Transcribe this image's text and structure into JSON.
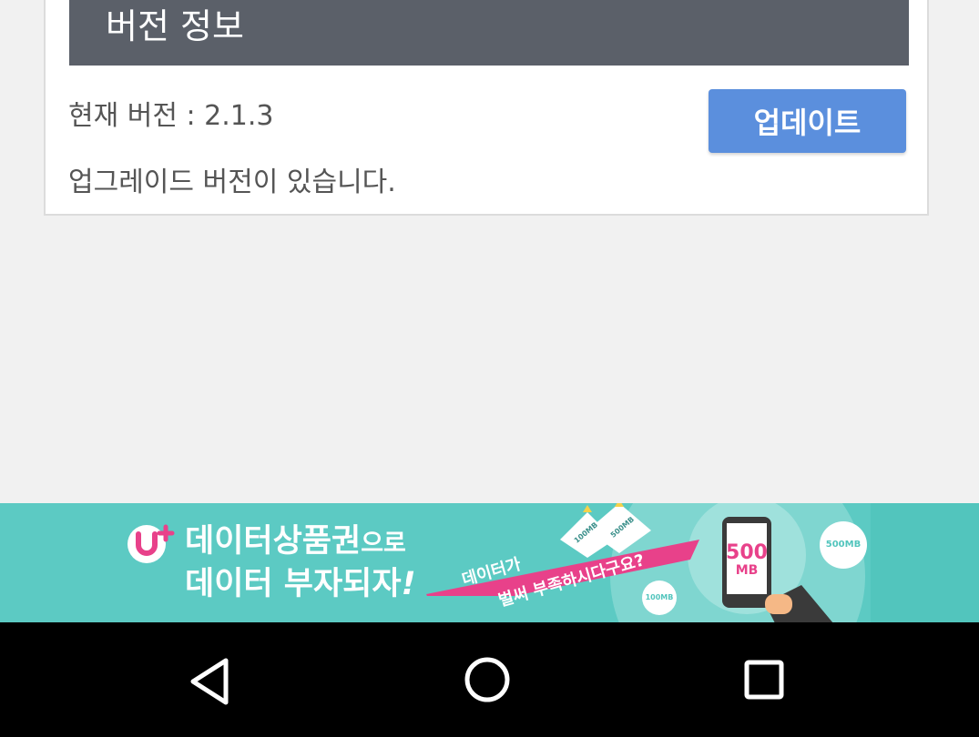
{
  "version_card": {
    "title": "버전 정보",
    "current_version_text": "현재 버전 : 2.1.3",
    "upgrade_notice": "업그레이드 버전이 있습니다.",
    "update_button_label": "업데이트"
  },
  "ad_banner": {
    "headline_line1_main": "데이터상품권",
    "headline_line1_small": "으로",
    "headline_line2_main": "데이터 부자되자",
    "headline_line2_suffix": "!",
    "ribbon_text_line1": "데이터가",
    "ribbon_text_line2": "벌써 부족하시다구요?",
    "phone_value": "500",
    "phone_unit": "MB",
    "badge_large": "500MB",
    "badge_small": "100MB",
    "ticket_label_1": "100MB",
    "ticket_label_2": "500MB",
    "logo_icon": "lg-uplus-logo-icon",
    "colors": {
      "background": "#52c5bd",
      "accent_pink": "#e8418a"
    }
  },
  "nav_bar": {
    "back_icon": "back-triangle-icon",
    "home_icon": "home-circle-icon",
    "recent_icon": "recent-apps-square-icon"
  },
  "colors": {
    "header_bg": "#5b6069",
    "button_bg": "#5b8fdd",
    "page_bg": "#f1f1f1"
  }
}
